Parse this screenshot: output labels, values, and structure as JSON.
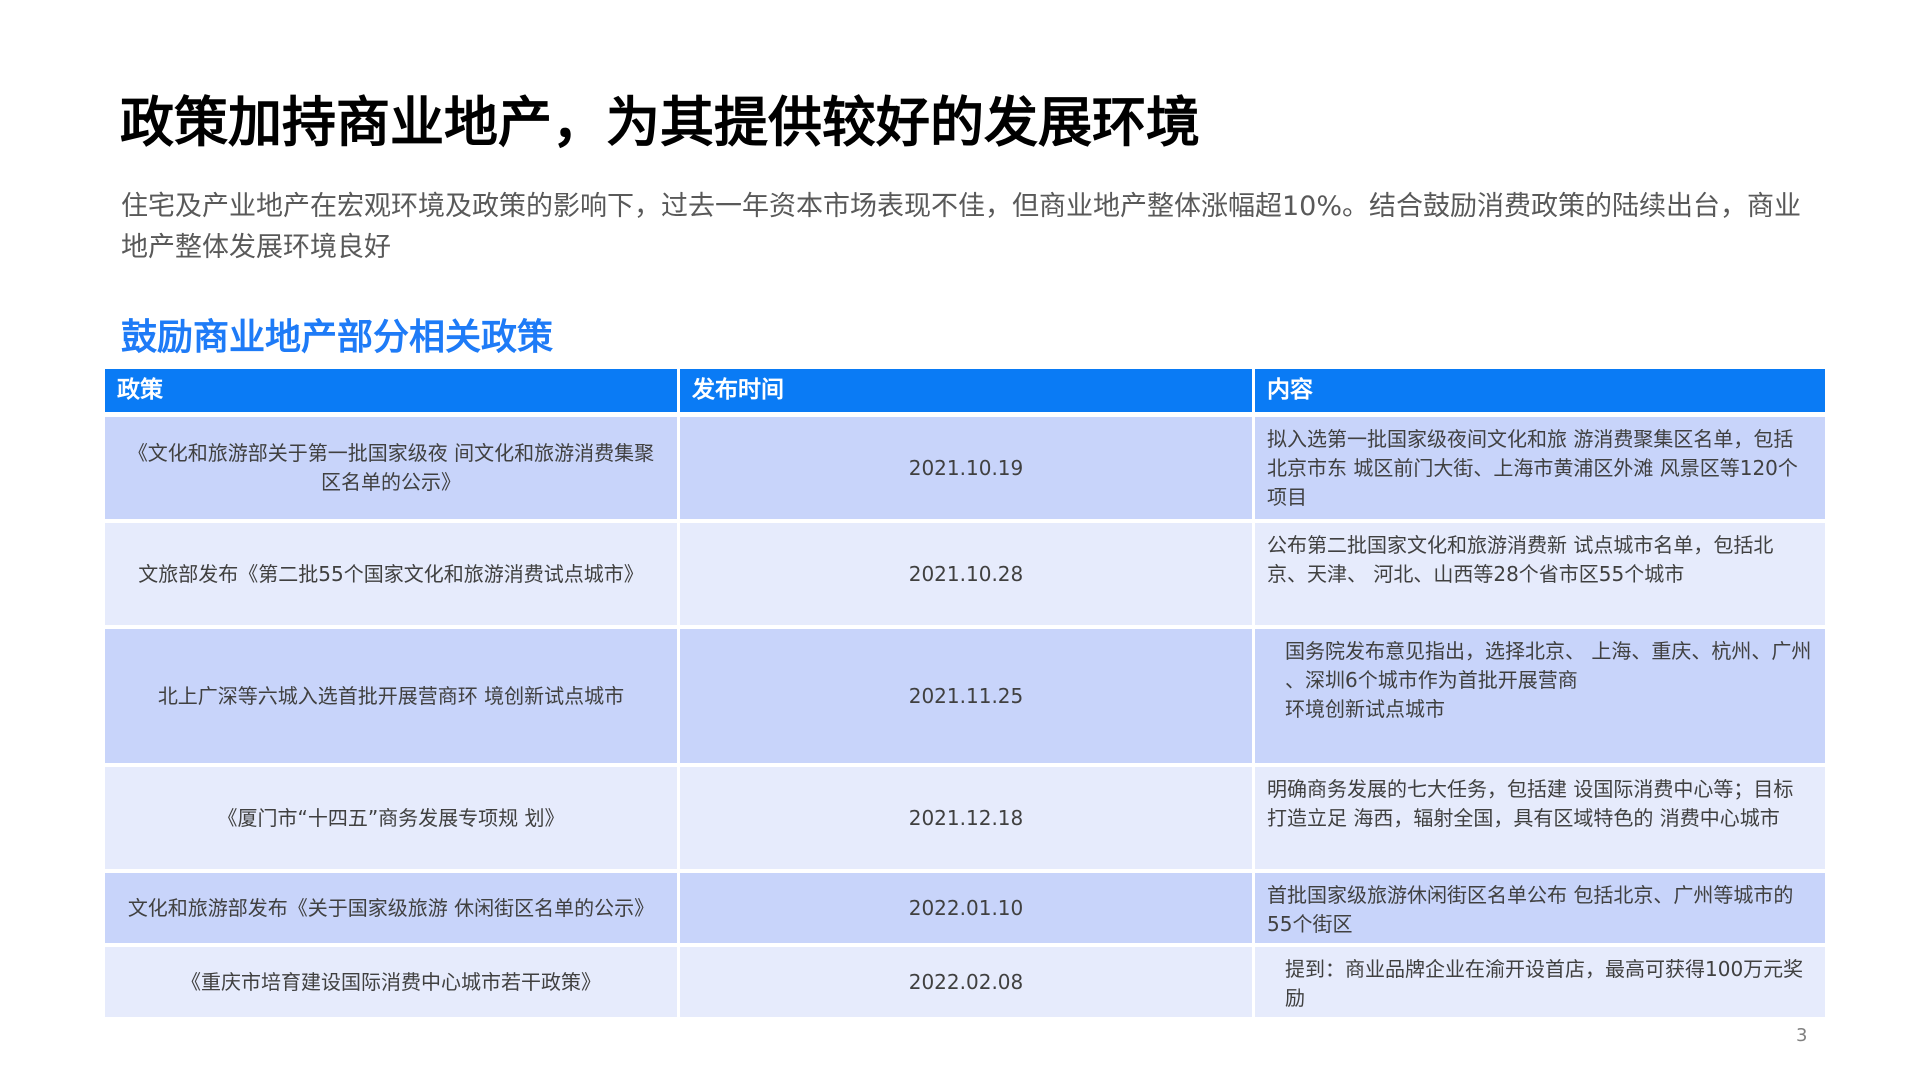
{
  "slide": {
    "title": "政策加持商业地产，为其提供较好的发展环境",
    "subtitle": "住宅及产业地产在宏观环境及政策的影响下，过去一年资本市场表现不佳，但商业地产整体涨幅超10%。结合鼓励消费政策的陆续出台，商业地产整体发展环境良好",
    "section_title": "鼓励商业地产部分相关政策",
    "page_number": "3"
  },
  "table": {
    "headers": [
      "政策",
      "发布时间",
      "内容"
    ],
    "rows": [
      {
        "policy": "《文化和旅游部关于第一批国家级夜 间文化和旅游消费集聚区名单的公示》",
        "date": "2021.10.19",
        "content": "拟入选第一批国家级夜间文化和旅 游消费聚集区名单，包括北京市东 城区前门大街、上海市黄浦区外滩 风景区等120个项目"
      },
      {
        "policy": "文旅部发布《第二批55个国家文化和旅游消费试点城市》",
        "date": "2021.10.28",
        "content": "公布第二批国家文化和旅游消费新 试点城市名单，包括北京、天津、 河北、山西等28个省市区55个城市"
      },
      {
        "policy": "北上广深等六城入选首批开展营商环 境创新试点城市",
        "date": "2021.11.25",
        "content_lines": [
          "国务院发布意见指出，选择北京、 上海、重庆、杭州、广州",
          "、深圳6个城市作为首批开展营商",
          "环境创新试点城市"
        ]
      },
      {
        "policy": "《厦门市“十四五”商务发展专项规 划》",
        "date": "2021.12.18",
        "content": "明确商务发展的七大任务，包括建 设国际消费中心等；目标打造立足 海西，辐射全国，具有区域特色的 消费中心城市"
      },
      {
        "policy": "文化和旅游部发布《关于国家级旅游 休闲街区名单的公示》",
        "date": "2022.01.10",
        "content": "首批国家级旅游休闲街区名单公布 包括北京、广州等城市的55个街区"
      },
      {
        "policy": "《重庆市培育建设国际消费中心城市若干政策》",
        "date": "2022.02.08",
        "content": "提到：商业品牌企业在渝开设首店，最高可获得100万元奖励"
      }
    ]
  },
  "colors": {
    "accent": "#1E7BF7",
    "header_bg": "#0A7BF5",
    "row_dark": "#C8D4FA",
    "row_light": "#E6EBFC"
  }
}
